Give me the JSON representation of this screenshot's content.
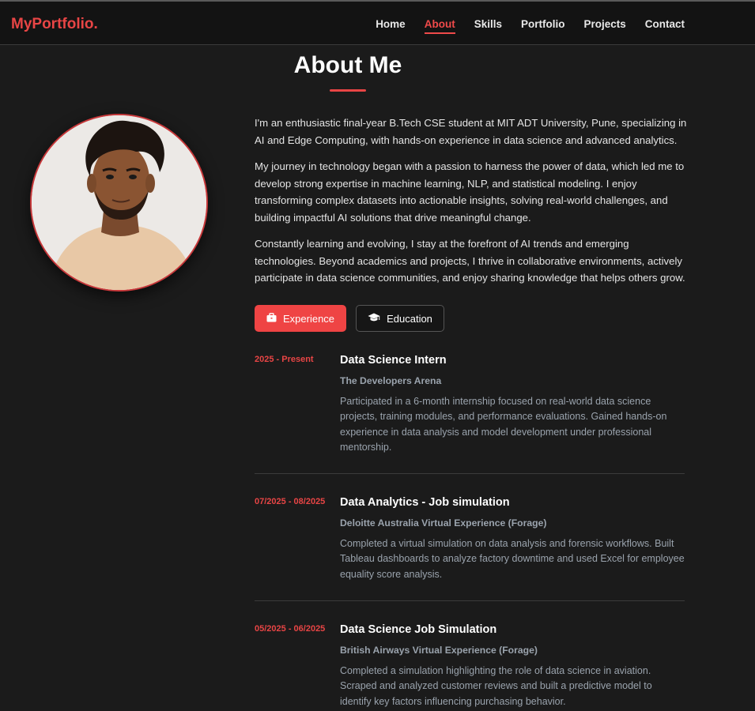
{
  "nav": {
    "logo": "MyPortfolio.",
    "links": [
      "Home",
      "About",
      "Skills",
      "Portfolio",
      "Projects",
      "Contact"
    ],
    "active": "About"
  },
  "about": {
    "title": "About Me",
    "paragraphs": [
      "I'm an enthusiastic final-year B.Tech CSE student at MIT ADT University, Pune, specializing in AI and Edge Computing, with hands-on experience in data science and advanced analytics.",
      "My journey in technology began with a passion to harness the power of data, which led me to develop strong expertise in machine learning, NLP, and statistical modeling. I enjoy transforming complex datasets into actionable insights, solving real-world challenges, and building impactful AI solutions that drive meaningful change.",
      "Constantly learning and evolving, I stay at the forefront of AI trends and emerging technologies. Beyond academics and projects, I thrive in collaborative environments, actively participate in data science communities, and enjoy sharing knowledge that helps others grow."
    ]
  },
  "tabs": {
    "experience": "Experience",
    "education": "Education"
  },
  "timeline": [
    {
      "date": "2025 - Present",
      "title": "Data Science Intern",
      "org": "The Developers Arena",
      "desc": "Participated in a 6-month internship focused on real-world data science projects, training modules, and performance evaluations. Gained hands-on experience in data analysis and model development under professional mentorship."
    },
    {
      "date": "07/2025 - 08/2025",
      "title": "Data Analytics - Job simulation",
      "org": "Deloitte Australia Virtual Experience (Forage)",
      "desc": "Completed a virtual simulation on data analysis and forensic workflows. Built Tableau dashboards to analyze factory downtime and used Excel for employee equality score analysis."
    },
    {
      "date": "05/2025 - 06/2025",
      "title": "Data Science Job Simulation",
      "org": "British Airways Virtual Experience (Forage)",
      "desc": "Completed a simulation highlighting the role of data science in aviation. Scraped and analyzed customer reviews and built a predictive model to identify key factors influencing purchasing behavior."
    }
  ],
  "colors": {
    "accent": "#ef4444",
    "background": "#1b1b1b",
    "navbar": "#131313"
  }
}
